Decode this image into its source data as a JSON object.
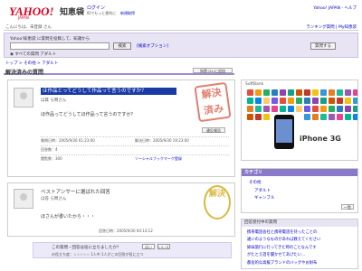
{
  "header": {
    "logo": "YAHOO!",
    "logo_sub": "JAPAN",
    "site_title": "知恵袋",
    "login_link": "ログイン",
    "login_note": "IDでもっと便利に",
    "register_link": "新規取得",
    "top_right_links": "Yahoo! JAPAN - ヘルプ"
  },
  "welcome_bar": {
    "left": "こんにちは、未登録 さん",
    "right": "ランキング質問 | My知恵袋"
  },
  "search": {
    "label": "Yahoo!知恵袋 に質問を投稿して、知識から",
    "input_value": "",
    "button": "検索",
    "options_link": "[検索オプション]",
    "radio_label": "すべての質問 アダルト",
    "right_button": "質問する"
  },
  "breadcrumb": "トップ > その他 > アダルト",
  "section": {
    "title": "解決済みの質問",
    "button": "知恵コレに追加"
  },
  "question": {
    "title": "ほ作品とってどうして作品って言うのですか？",
    "user": "ほ質 ら問さん",
    "body": "ほ作品ってどうしてほ作品って言うのですか？",
    "stamp": "解決済み",
    "reply_button": "違反報告",
    "meta1_left": "質問日時：2005/9/30 01:23:00",
    "meta1_right": "解決日時：2005/9/30 19:23:00",
    "meta2_left": "回答数：4",
    "meta3_left": "閲覧数：300",
    "meta3_right": "ソーシャルブックマーク登録"
  },
  "best_answer": {
    "title": "ベストアンサーに選ばれた回答",
    "user": "ほ答 ら問さん",
    "body": "ほさんが書いたから・・・",
    "stamp": "解決",
    "meta": "回答日時：2005/9/30 04:13:12"
  },
  "vote": {
    "question": "この質問・回答は役に立ちましたか？",
    "yes": "はい",
    "no": "いいえ",
    "result": "お役立ち度：☆☆☆☆☆ 1人中 1人がこの回答が役に立つ"
  },
  "ad": {
    "brand": "SoftBank",
    "product": "iPhone 3G",
    "icon_colors": [
      "#e74c3c",
      "#f39c12",
      "#27ae60",
      "#2980b9",
      "#8e44ad",
      "#16a085",
      "#d35400",
      "#c0392b",
      "#f1c40f",
      "#3498db",
      "#e67e22",
      "#1abc9c",
      "#9b59b6",
      "#e84393",
      "#00b894",
      "#0984e3",
      "#fdcb6e",
      "#6c5ce7"
    ]
  },
  "categories": {
    "title": "カテゴリ",
    "items": [
      "その他",
      "アダルト",
      "ギャンブル"
    ],
    "more": "一覧"
  },
  "related": {
    "title": "回答受付中の質問",
    "items": [
      "携帯電話会社と携帯電話を持ったことの",
      "違いのようなものがあれば教えてください",
      "姉妹旅行に行ってきた時のことなんです",
      "がたとえ話を聞かせてあげたい…",
      "都会的な高級ブランドのバッグやお財布"
    ]
  }
}
